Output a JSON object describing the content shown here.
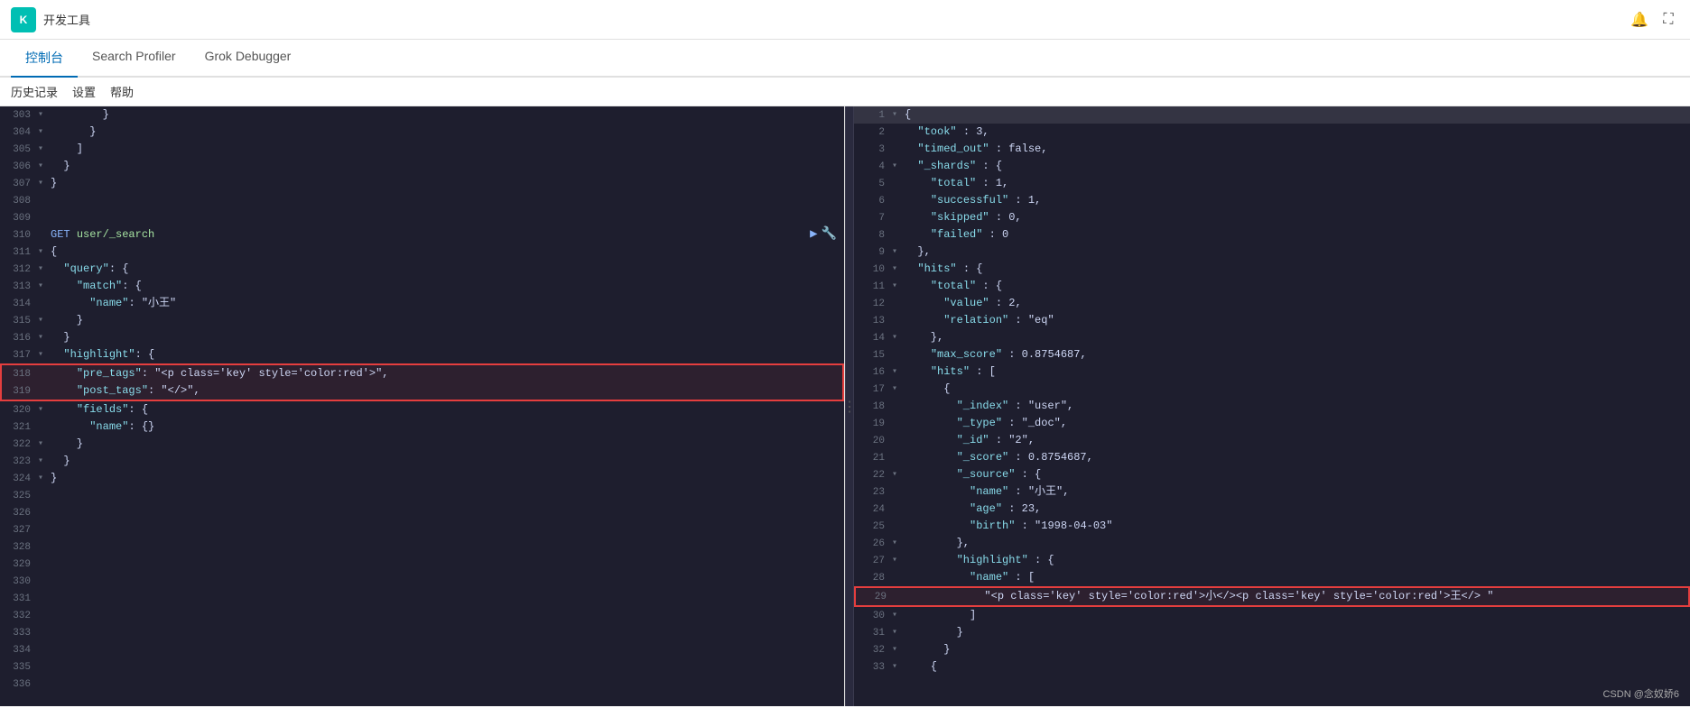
{
  "topbar": {
    "logo_text": "K",
    "title": "开发工具",
    "bell_icon": "🔔",
    "expand_icon": "⛶"
  },
  "nav": {
    "tabs": [
      {
        "id": "console",
        "label": "控制台",
        "active": true
      },
      {
        "id": "search-profiler",
        "label": "Search Profiler",
        "active": false
      },
      {
        "id": "grok-debugger",
        "label": "Grok Debugger",
        "active": false
      }
    ]
  },
  "toolbar": {
    "history": "历史记录",
    "settings": "设置",
    "help": "帮助"
  },
  "left_panel": {
    "lines": [
      {
        "num": 303,
        "toggle": "-",
        "content": "        }"
      },
      {
        "num": 304,
        "toggle": "-",
        "content": "      }"
      },
      {
        "num": 305,
        "toggle": "-",
        "content": "    ]"
      },
      {
        "num": 306,
        "toggle": "-",
        "content": "  }"
      },
      {
        "num": 307,
        "toggle": "-",
        "content": "}"
      },
      {
        "num": 308,
        "toggle": " ",
        "content": ""
      },
      {
        "num": 309,
        "toggle": " ",
        "content": ""
      },
      {
        "num": 310,
        "toggle": " ",
        "content": "GET user/_search",
        "is_get": true
      },
      {
        "num": 311,
        "toggle": "-",
        "content": "{"
      },
      {
        "num": 312,
        "toggle": "-",
        "content": "  \"query\": {"
      },
      {
        "num": 313,
        "toggle": "-",
        "content": "    \"match\": {"
      },
      {
        "num": 314,
        "toggle": " ",
        "content": "      \"name\": \"小王\""
      },
      {
        "num": 315,
        "toggle": "-",
        "content": "    }"
      },
      {
        "num": 316,
        "toggle": "-",
        "content": "  }"
      },
      {
        "num": 317,
        "toggle": "-",
        "content": "  \"highlight\": {"
      },
      {
        "num": 318,
        "toggle": " ",
        "content": "    \"pre_tags\": \"<p class='key' style='color:red'>\",",
        "red_box": "start"
      },
      {
        "num": 319,
        "toggle": " ",
        "content": "    \"post_tags\": \"</>\",",
        "red_box": "end"
      },
      {
        "num": 320,
        "toggle": "-",
        "content": "    \"fields\": {"
      },
      {
        "num": 321,
        "toggle": " ",
        "content": "      \"name\": {}"
      },
      {
        "num": 322,
        "toggle": "-",
        "content": "    }"
      },
      {
        "num": 323,
        "toggle": "-",
        "content": "  }"
      },
      {
        "num": 324,
        "toggle": "-",
        "content": "}"
      },
      {
        "num": 325,
        "toggle": " ",
        "content": ""
      },
      {
        "num": 326,
        "toggle": " ",
        "content": ""
      },
      {
        "num": 327,
        "toggle": " ",
        "content": ""
      },
      {
        "num": 328,
        "toggle": " ",
        "content": ""
      },
      {
        "num": 329,
        "toggle": " ",
        "content": ""
      },
      {
        "num": 330,
        "toggle": " ",
        "content": ""
      },
      {
        "num": 331,
        "toggle": " ",
        "content": ""
      },
      {
        "num": 332,
        "toggle": " ",
        "content": ""
      },
      {
        "num": 333,
        "toggle": " ",
        "content": ""
      },
      {
        "num": 334,
        "toggle": " ",
        "content": ""
      },
      {
        "num": 335,
        "toggle": " ",
        "content": ""
      },
      {
        "num": 336,
        "toggle": " ",
        "content": ""
      }
    ]
  },
  "right_panel": {
    "lines": [
      {
        "num": 1,
        "toggle": "-",
        "content": "{"
      },
      {
        "num": 2,
        "toggle": " ",
        "content": "  \"took\" : 3,"
      },
      {
        "num": 3,
        "toggle": " ",
        "content": "  \"timed_out\" : false,"
      },
      {
        "num": 4,
        "toggle": "-",
        "content": "  \"_shards\" : {"
      },
      {
        "num": 5,
        "toggle": " ",
        "content": "    \"total\" : 1,"
      },
      {
        "num": 6,
        "toggle": " ",
        "content": "    \"successful\" : 1,"
      },
      {
        "num": 7,
        "toggle": " ",
        "content": "    \"skipped\" : 0,"
      },
      {
        "num": 8,
        "toggle": " ",
        "content": "    \"failed\" : 0"
      },
      {
        "num": 9,
        "toggle": "-",
        "content": "  },"
      },
      {
        "num": 10,
        "toggle": "-",
        "content": "  \"hits\" : {"
      },
      {
        "num": 11,
        "toggle": "-",
        "content": "    \"total\" : {"
      },
      {
        "num": 12,
        "toggle": " ",
        "content": "      \"value\" : 2,"
      },
      {
        "num": 13,
        "toggle": " ",
        "content": "      \"relation\" : \"eq\""
      },
      {
        "num": 14,
        "toggle": "-",
        "content": "    },"
      },
      {
        "num": 15,
        "toggle": " ",
        "content": "    \"max_score\" : 0.8754687,"
      },
      {
        "num": 16,
        "toggle": "-",
        "content": "    \"hits\" : ["
      },
      {
        "num": 17,
        "toggle": "-",
        "content": "      {"
      },
      {
        "num": 18,
        "toggle": " ",
        "content": "        \"_index\" : \"user\","
      },
      {
        "num": 19,
        "toggle": " ",
        "content": "        \"_type\" : \"_doc\","
      },
      {
        "num": 20,
        "toggle": " ",
        "content": "        \"_id\" : \"2\","
      },
      {
        "num": 21,
        "toggle": " ",
        "content": "        \"_score\" : 0.8754687,"
      },
      {
        "num": 22,
        "toggle": "-",
        "content": "        \"_source\" : {"
      },
      {
        "num": 23,
        "toggle": " ",
        "content": "          \"name\" : \"小王\","
      },
      {
        "num": 24,
        "toggle": " ",
        "content": "          \"age\" : 23,"
      },
      {
        "num": 25,
        "toggle": " ",
        "content": "          \"birth\" : \"1998-04-03\""
      },
      {
        "num": 26,
        "toggle": "-",
        "content": "        },"
      },
      {
        "num": 27,
        "toggle": "-",
        "content": "        \"highlight\" : {"
      },
      {
        "num": 28,
        "toggle": " ",
        "content": "          \"name\" : ["
      },
      {
        "num": 29,
        "toggle": " ",
        "content": "            \"<p class='key' style='color:red'>小</><p class='key' style='color:red'>王</> \"",
        "red_box": "single"
      },
      {
        "num": 30,
        "toggle": "-",
        "content": "          ]"
      },
      {
        "num": 31,
        "toggle": "-",
        "content": "        }"
      },
      {
        "num": 32,
        "toggle": "-",
        "content": "      }"
      },
      {
        "num": 33,
        "toggle": "-",
        "content": "    {"
      }
    ]
  },
  "watermark": "CSDN @念奴娇6"
}
